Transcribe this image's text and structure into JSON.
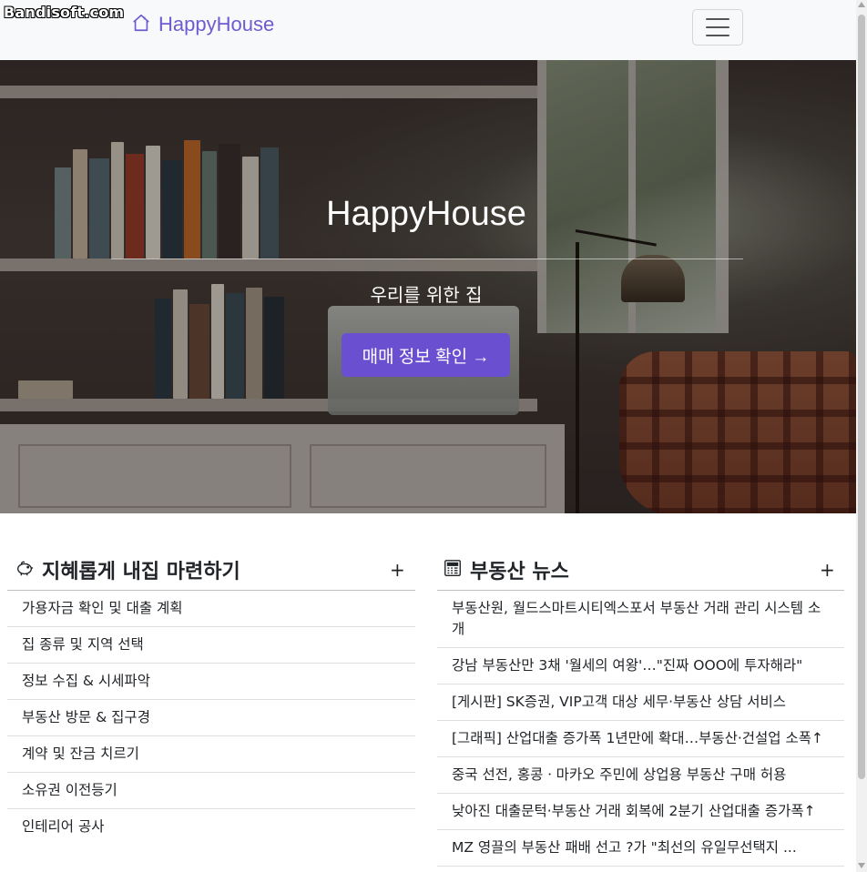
{
  "watermark": "Bandisoft.com",
  "navbar": {
    "brand": "HappyHouse",
    "brand_icon": "house-icon",
    "toggler_icon": "hamburger-menu-icon"
  },
  "hero": {
    "title": "HappyHouse",
    "subtitle": "우리를 위한 집",
    "button_label": "매매 정보 확인 →"
  },
  "guide_section": {
    "icon": "piggy-bank-icon",
    "title": "지혜롭게 내집 마련하기",
    "toggle": "+",
    "items": [
      "가용자금 확인 및 대출 계획",
      "집 종류 및 지역 선택",
      "정보 수집 & 시세파악",
      "부동산 방문 & 집구경",
      "계약 및 잔금 치르기",
      "소유권 이전등기",
      "인테리어 공사"
    ]
  },
  "news_section": {
    "icon": "calculator-icon",
    "title": "부동산 뉴스",
    "toggle": "+",
    "items": [
      "부동산원, 월드스마트시티엑스포서 부동산 거래 관리 시스템 소개",
      "강남 부동산만 3채 '월세의 여왕'…\"진짜 OOO에 투자해라\"",
      "[게시판] SK증권, VIP고객 대상 세무·부동산 상담 서비스",
      "[그래픽] 산업대출 증가폭 1년만에 확대…부동산·건설업 소폭↑",
      "중국 선전, 홍콩ㆍ마카오 주민에 상업용 부동산 구매 허용",
      "낮아진 대출문턱·부동산 거래 회복에 2분기 산업대출 증가폭↑",
      "MZ 영끌의 부동산 패배 선고 ?가 \"최선의 유일무선택지 ..."
    ]
  },
  "colors": {
    "brand": "#6f5bcf",
    "button": "#6a4fd1",
    "navbar_bg": "#f8f9fa"
  }
}
